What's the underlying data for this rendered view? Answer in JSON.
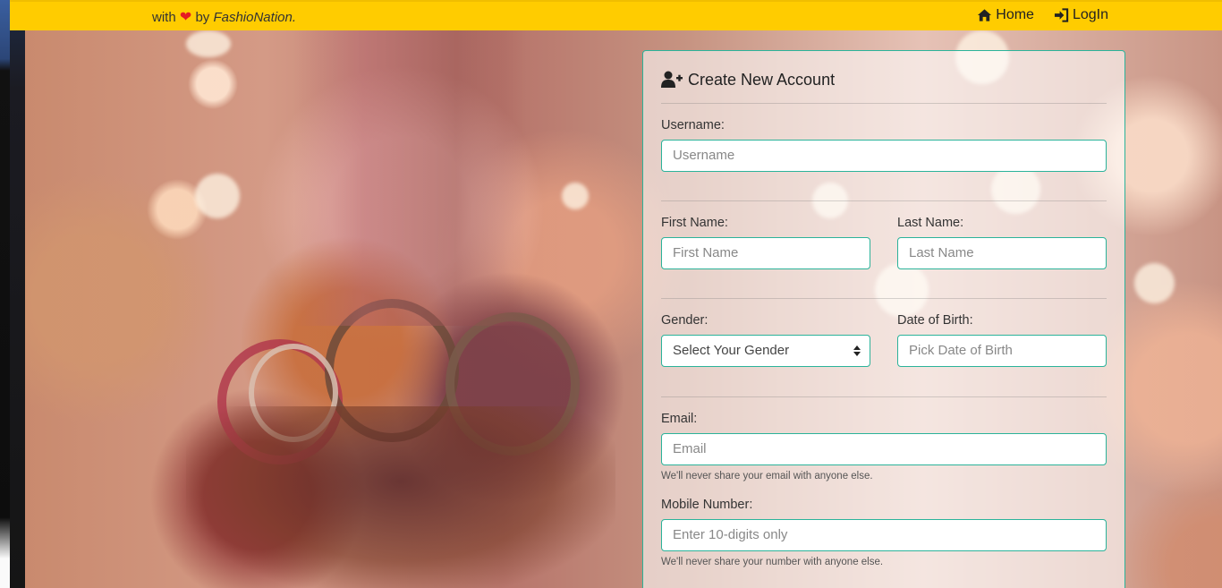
{
  "brand": {
    "prefix": "with",
    "heart_icon": "heart-icon",
    "by": "by",
    "name": "FashioNation."
  },
  "nav": {
    "home": {
      "label": "Home",
      "icon": "home-icon"
    },
    "login": {
      "label": "LogIn",
      "icon": "sign-in-icon"
    }
  },
  "form": {
    "title": "Create New Account",
    "title_icon": "user-plus-icon",
    "username": {
      "label": "Username:",
      "placeholder": "Username"
    },
    "first_name": {
      "label": "First Name:",
      "placeholder": "First Name"
    },
    "last_name": {
      "label": "Last Name:",
      "placeholder": "Last Name"
    },
    "gender": {
      "label": "Gender:",
      "selected": "Select Your Gender"
    },
    "dob": {
      "label": "Date of Birth:",
      "placeholder": "Pick Date of Birth"
    },
    "email": {
      "label": "Email:",
      "placeholder": "Email",
      "help": "We'll never share your email with anyone else."
    },
    "mobile": {
      "label": "Mobile Number:",
      "placeholder": "Enter 10-digits only",
      "help": "We'll never share your number with anyone else."
    }
  },
  "colors": {
    "topbar": "#ffcc00",
    "accent_border": "#2bb39a",
    "heart": "#e51c23"
  }
}
